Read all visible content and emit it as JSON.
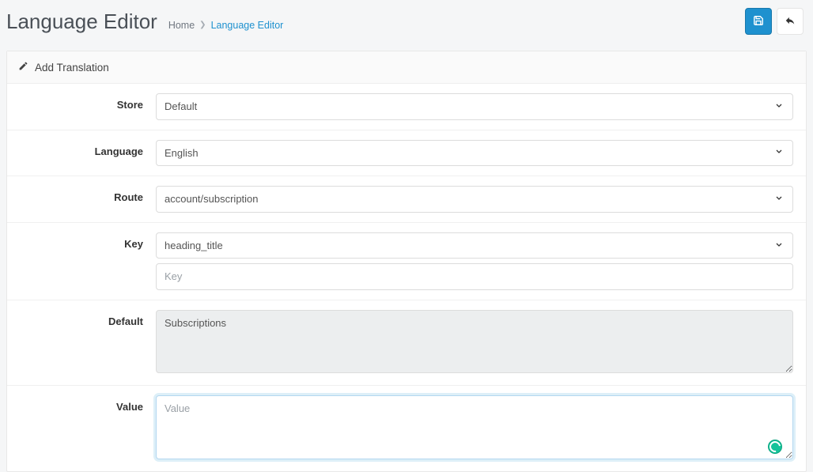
{
  "header": {
    "title": "Language Editor",
    "breadcrumb": {
      "home": "Home",
      "current": "Language Editor"
    }
  },
  "actions": {
    "save_title": "Save",
    "back_title": "Back"
  },
  "panel": {
    "title": "Add Translation"
  },
  "form": {
    "store": {
      "label": "Store",
      "value": "Default"
    },
    "language": {
      "label": "Language",
      "value": "English"
    },
    "route": {
      "label": "Route",
      "value": "account/subscription"
    },
    "key": {
      "label": "Key",
      "value": "heading_title",
      "input_placeholder": "Key",
      "input_value": ""
    },
    "default": {
      "label": "Default",
      "value": "Subscriptions"
    },
    "value": {
      "label": "Value",
      "placeholder": "Value",
      "value": ""
    }
  }
}
